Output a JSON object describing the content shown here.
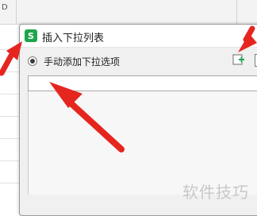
{
  "sheet": {
    "column_letter": "D"
  },
  "dialog": {
    "app_icon_letter": "S",
    "title": "插入下拉列表",
    "radio_label": "手动添加下拉选项",
    "option_value": ""
  },
  "watermark": "软件技巧",
  "icons": {
    "add": "add-item-icon",
    "arrow": "red-arrow-annotation"
  },
  "colors": {
    "accent_green": "#1fa54b",
    "arrow_red": "#e5261f"
  }
}
